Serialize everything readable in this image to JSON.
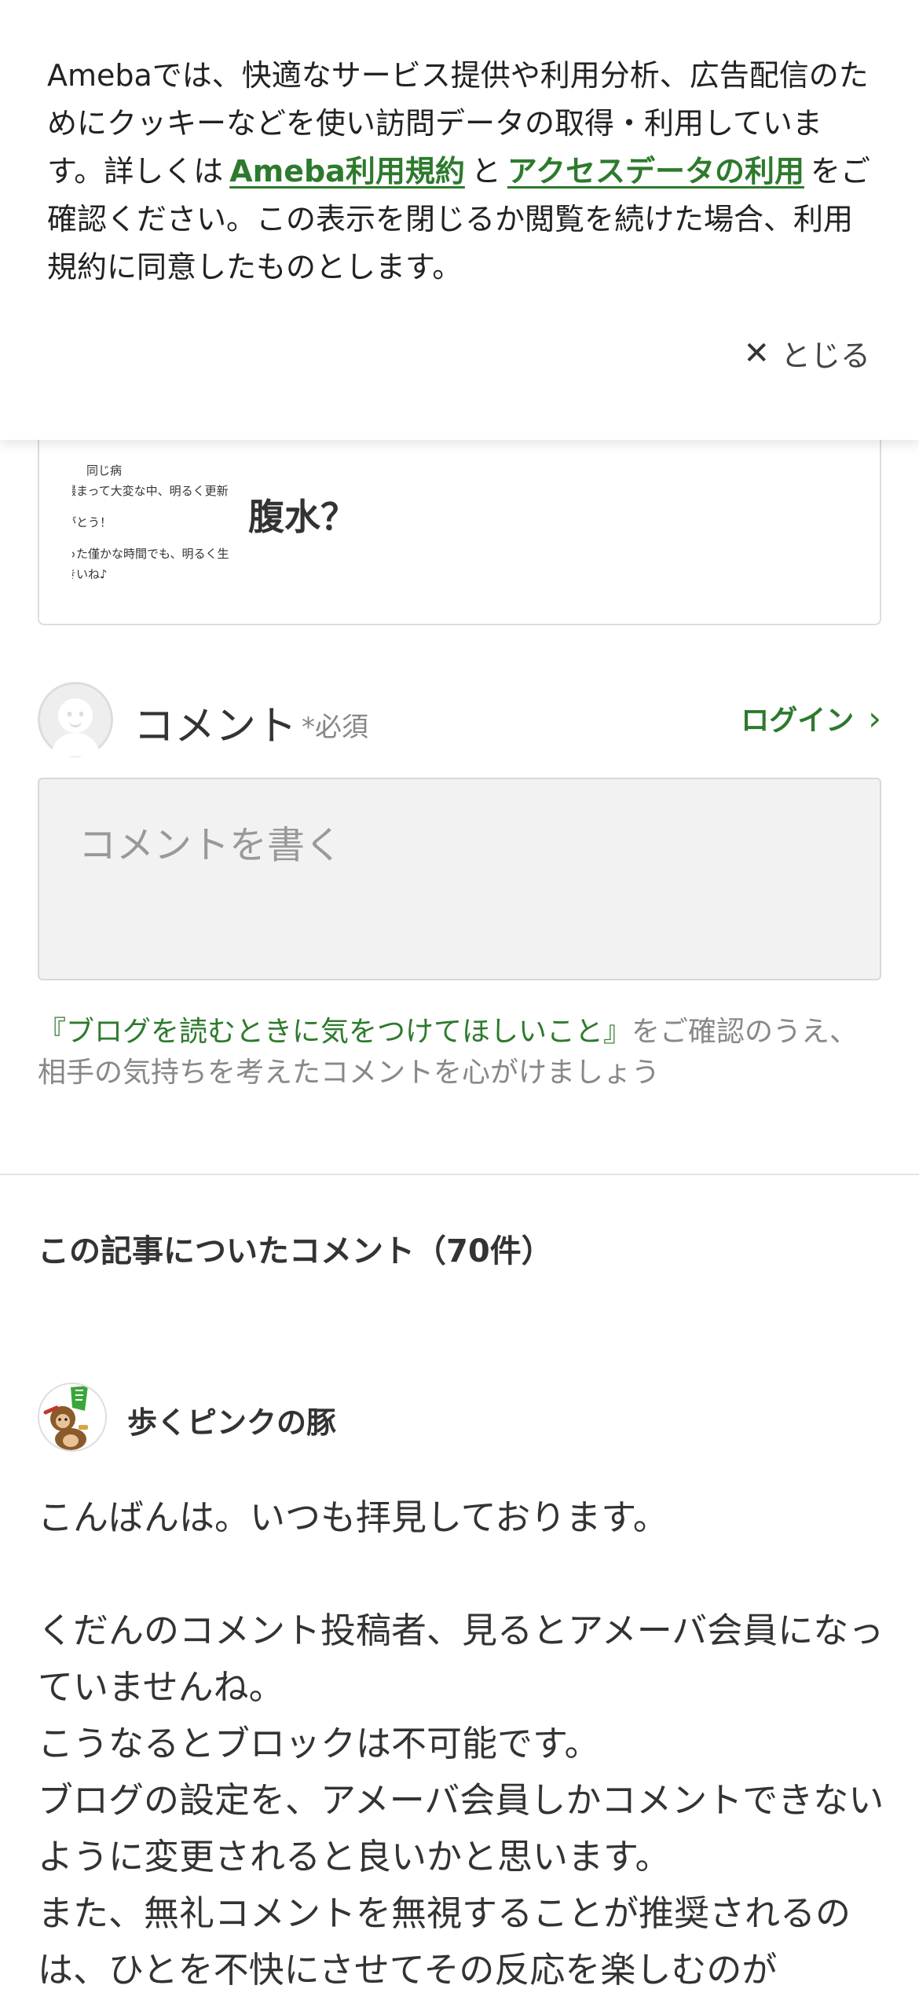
{
  "cookie_banner": {
    "text_before": "Amebaでは、快適なサービス提供や利用分析、広告配信のためにクッキーなどを使い訪問データの取得・利用しています。詳しくは",
    "link_terms": "Ameba利用規約",
    "text_and": "と",
    "link_access": "アクセスデータの利用",
    "text_after": "をご確認ください。この表示を閉じるか閲覧を続けた場合、利用規約に同意したものとします。",
    "close_label": "とじる"
  },
  "article_card": {
    "thumbnail_lines": [
      "同じ病",
      "撮まって大変な中、明るく更新",
      "がとう！",
      "った僅かな時間でも、明るく生",
      "きいね♪"
    ],
    "title": "腹水？"
  },
  "comment_form": {
    "label": "コメント",
    "required": "*必須",
    "login": "ログイン",
    "placeholder": "コメントを書く"
  },
  "guideline": {
    "link": "『ブログを読むときに気をつけてほしいこと』",
    "text": "をご確認のうえ、相手の気持ちを考えたコメントを心がけましょう"
  },
  "comments_section": {
    "title": "この記事についたコメント（70件）"
  },
  "comments": [
    {
      "author": "歩くピンクの豚",
      "body": "こんばんは。いつも拝見しております。\n\nくだんのコメント投稿者、見るとアメーバ会員になっていませんね。\nこうなるとブロックは不可能です。\nブログの設定を、アメーバ会員しかコメントできないように変更されると良いかと思います。\nまた、無礼コメントを無視することが推奨されるのは、ひとを不快にさせてその反応を楽しむのが"
    }
  ],
  "colors": {
    "accent_green": "#2d7a2d",
    "text_dark": "#333333",
    "text_muted": "#888888",
    "input_bg": "#f2f2f2"
  }
}
